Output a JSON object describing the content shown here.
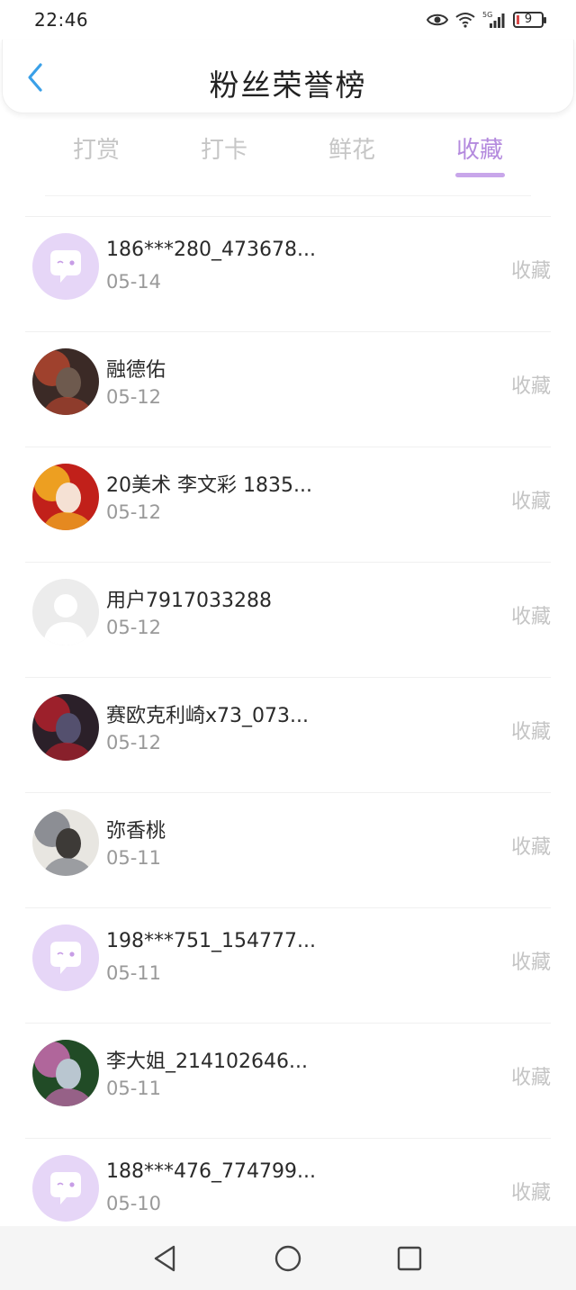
{
  "status": {
    "time": "22:46",
    "battery_level": "9"
  },
  "header": {
    "title": "粉丝荣誉榜"
  },
  "tabs": [
    {
      "label": "打赏"
    },
    {
      "label": "打卡"
    },
    {
      "label": "鲜花"
    },
    {
      "label": "收藏"
    }
  ],
  "active_tab": "收藏",
  "colors": {
    "accent": "#b48ade",
    "indicator": "#c8a6ea",
    "back": "#3aa0e8",
    "default_avatar": "#e6d6f7"
  },
  "fans": [
    {
      "name": "186***280_473678...",
      "date": "05-14",
      "action": "收藏",
      "avatar": "default-chat-avatar"
    },
    {
      "name": "融德佑",
      "date": "05-12",
      "action": "收藏",
      "avatar": "photo-avatar"
    },
    {
      "name": "20美术 李文彩 1835...",
      "date": "05-12",
      "action": "收藏",
      "avatar": "photo-avatar"
    },
    {
      "name": "用户7917033288",
      "date": "05-12",
      "action": "收藏",
      "avatar": "blank-user-avatar"
    },
    {
      "name": "赛欧克利崎x73_073...",
      "date": "05-12",
      "action": "收藏",
      "avatar": "photo-avatar"
    },
    {
      "name": "弥香桃",
      "date": "05-11",
      "action": "收藏",
      "avatar": "photo-avatar"
    },
    {
      "name": "198***751_154777...",
      "date": "05-11",
      "action": "收藏",
      "avatar": "default-chat-avatar"
    },
    {
      "name": "李大姐_214102646...",
      "date": "05-11",
      "action": "收藏",
      "avatar": "photo-avatar"
    },
    {
      "name": "188***476_774799...",
      "date": "05-10",
      "action": "收藏",
      "avatar": "default-chat-avatar"
    }
  ]
}
